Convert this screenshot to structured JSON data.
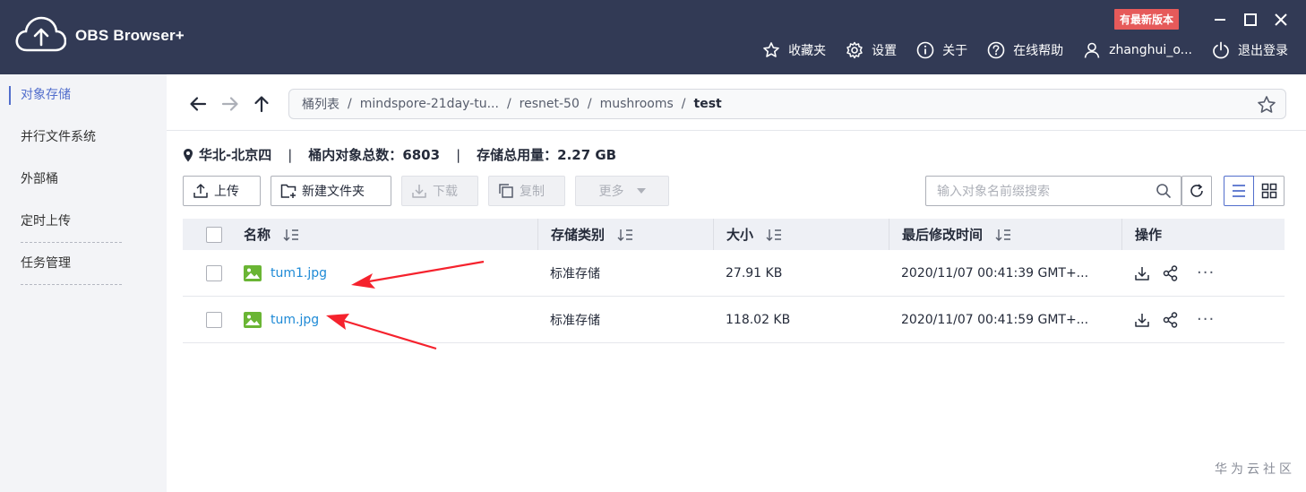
{
  "header": {
    "app_title": "OBS Browser+",
    "new_version_badge": "有最新版本",
    "nav": [
      {
        "label": "收藏夹",
        "icon": "star-icon"
      },
      {
        "label": "设置",
        "icon": "gear-icon"
      },
      {
        "label": "关于",
        "icon": "info-icon"
      },
      {
        "label": "在线帮助",
        "icon": "help-icon"
      },
      {
        "label": "zhanghui_o...",
        "icon": "user-icon"
      },
      {
        "label": "退出登录",
        "icon": "power-icon"
      }
    ]
  },
  "sidebar": {
    "items": [
      {
        "label": "对象存储",
        "active": true
      },
      {
        "label": "并行文件系统",
        "active": false
      },
      {
        "label": "外部桶",
        "active": false
      },
      {
        "label": "定时上传",
        "active": false
      },
      {
        "label": "任务管理",
        "active": false
      }
    ]
  },
  "breadcrumb": {
    "items": [
      "桶列表",
      "mindspore-21day-tu...",
      "resnet-50",
      "mushrooms",
      "test"
    ],
    "separator": "/"
  },
  "info": {
    "region": "华北-北京四",
    "object_count_label": "桶内对象总数：",
    "object_count": "6803",
    "storage_label": "存储总用量：",
    "storage_used": "2.27 GB",
    "pipe": "|"
  },
  "toolbar": {
    "upload": "上传",
    "new_folder": "新建文件夹",
    "download": "下载",
    "copy": "复制",
    "more": "更多"
  },
  "search": {
    "placeholder": "输入对象名前缀搜索"
  },
  "table": {
    "columns": [
      "名称",
      "存储类别",
      "大小",
      "最后修改时间",
      "操作"
    ],
    "rows": [
      {
        "name": "tum1.jpg",
        "storage_class": "标准存储",
        "size": "27.91 KB",
        "modified": "2020/11/07 00:41:39 GMT+..."
      },
      {
        "name": "tum.jpg",
        "storage_class": "标准存储",
        "size": "118.02 KB",
        "modified": "2020/11/07 00:41:59 GMT+..."
      }
    ],
    "more_ops": "···"
  },
  "watermark": "华为云社区",
  "colors": {
    "header_bg": "#323a55",
    "accent": "#526ecc",
    "link": "#1e8ad6",
    "badge": "#e65a5a",
    "annotation_arrow": "#f5222d",
    "file_icon": "#6ab534"
  }
}
